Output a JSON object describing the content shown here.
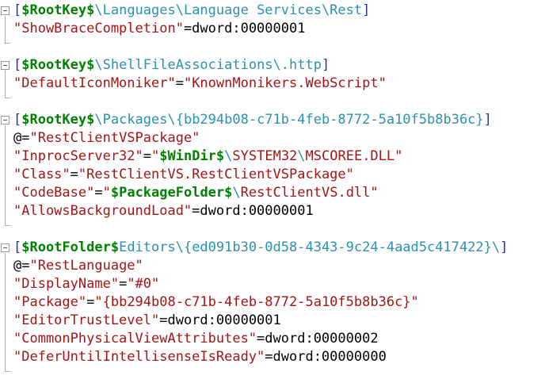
{
  "editor": {
    "kind": "pkgdef-registry-editor",
    "background": "#ffffff",
    "colors": {
      "bracket": "#28329b",
      "token": "#008000",
      "path": "#2b91af",
      "string": "#a31515",
      "plain": "#000000",
      "outline_margin": "#a9a9a9"
    },
    "outline": {
      "collapse_glyph": "minus",
      "state": "expanded"
    },
    "sections": [
      {
        "lines": [
          [
            {
              "t": "[",
              "c": "b"
            },
            {
              "t": "$RootKey$",
              "c": "g"
            },
            {
              "t": "\\Languages\\Language Services\\Rest",
              "c": "p"
            },
            {
              "t": "]",
              "c": "b"
            }
          ],
          [
            {
              "t": "\"ShowBraceCompletion\"",
              "c": "s"
            },
            {
              "t": "=dword:00000001",
              "c": "k"
            }
          ]
        ]
      },
      {
        "lines": [
          [
            {
              "t": "[",
              "c": "b"
            },
            {
              "t": "$RootKey$",
              "c": "g"
            },
            {
              "t": "\\ShellFileAssociations\\.http",
              "c": "p"
            },
            {
              "t": "]",
              "c": "b"
            }
          ],
          [
            {
              "t": "\"DefaultIconMoniker\"",
              "c": "s"
            },
            {
              "t": "=",
              "c": "k"
            },
            {
              "t": "\"KnownMonikers.WebScript\"",
              "c": "s"
            }
          ]
        ]
      },
      {
        "lines": [
          [
            {
              "t": "[",
              "c": "b"
            },
            {
              "t": "$RootKey$",
              "c": "g"
            },
            {
              "t": "\\Packages\\{bb294b08-c71b-4feb-8772-5a10f5b8b36c}",
              "c": "p"
            },
            {
              "t": "]",
              "c": "b"
            }
          ],
          [
            {
              "t": "@=",
              "c": "k"
            },
            {
              "t": "\"RestClientVSPackage\"",
              "c": "s"
            }
          ],
          [
            {
              "t": "\"InprocServer32\"",
              "c": "s"
            },
            {
              "t": "=",
              "c": "k"
            },
            {
              "t": "\"",
              "c": "s"
            },
            {
              "t": "$WinDir$",
              "c": "g"
            },
            {
              "t": "\\",
              "c": "p"
            },
            {
              "t": "SYSTEM32",
              "c": "s"
            },
            {
              "t": "\\",
              "c": "p"
            },
            {
              "t": "MSCOREE.DLL",
              "c": "s"
            },
            {
              "t": "\"",
              "c": "s"
            }
          ],
          [
            {
              "t": "\"Class\"",
              "c": "s"
            },
            {
              "t": "=",
              "c": "k"
            },
            {
              "t": "\"RestClientVS.RestClientVSPackage\"",
              "c": "s"
            }
          ],
          [
            {
              "t": "\"CodeBase\"",
              "c": "s"
            },
            {
              "t": "=",
              "c": "k"
            },
            {
              "t": "\"",
              "c": "s"
            },
            {
              "t": "$PackageFolder$",
              "c": "g"
            },
            {
              "t": "\\",
              "c": "p"
            },
            {
              "t": "RestClientVS.dll",
              "c": "s"
            },
            {
              "t": "\"",
              "c": "s"
            }
          ],
          [
            {
              "t": "\"AllowsBackgroundLoad\"",
              "c": "s"
            },
            {
              "t": "=dword:00000001",
              "c": "k"
            }
          ]
        ]
      },
      {
        "lines": [
          [
            {
              "t": "[",
              "c": "b"
            },
            {
              "t": "$RootFolder$",
              "c": "g"
            },
            {
              "t": "Editors\\{ed091b30-0d58-4343-9c24-4aad5c417422}\\",
              "c": "p"
            },
            {
              "t": "]",
              "c": "b"
            }
          ],
          [
            {
              "t": "@=",
              "c": "k"
            },
            {
              "t": "\"RestLanguage\"",
              "c": "s"
            }
          ],
          [
            {
              "t": "\"DisplayName\"",
              "c": "s"
            },
            {
              "t": "=",
              "c": "k"
            },
            {
              "t": "\"#0\"",
              "c": "s"
            }
          ],
          [
            {
              "t": "\"Package\"",
              "c": "s"
            },
            {
              "t": "=",
              "c": "k"
            },
            {
              "t": "\"{bb294b08-c71b-4feb-8772-5a10f5b8b36c}\"",
              "c": "s"
            }
          ],
          [
            {
              "t": "\"EditorTrustLevel\"",
              "c": "s"
            },
            {
              "t": "=dword:00000001",
              "c": "k"
            }
          ],
          [
            {
              "t": "\"CommonPhysicalViewAttributes\"",
              "c": "s"
            },
            {
              "t": "=dword:00000002",
              "c": "k"
            }
          ],
          [
            {
              "t": "\"DeferUntilIntellisenseIsReady\"",
              "c": "s"
            },
            {
              "t": "=dword:00000000",
              "c": "k"
            }
          ]
        ]
      }
    ]
  }
}
